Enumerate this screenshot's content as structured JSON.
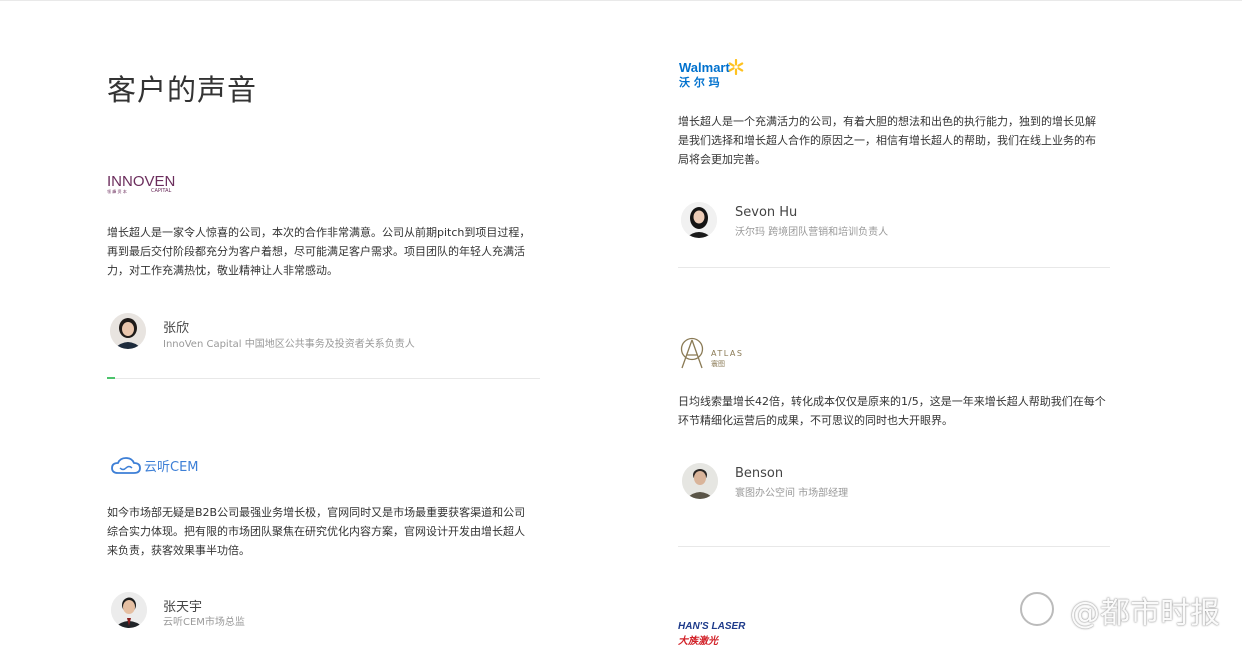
{
  "section_title": "客户的声音",
  "testimonials": [
    {
      "logo": {
        "name": "innoven-capital-logo",
        "main": "INNOVEN",
        "sub_cn": "领 峰 资 本",
        "sub_en": "CAPITAL"
      },
      "quote": "增长超人是一家令人惊喜的公司，本次的合作非常满意。公司从前期pitch到项目过程，再到最后交付阶段都充分为客户着想，尽可能满足客户需求。项目团队的年轻人充满活力，对工作充满热忱，敬业精神让人非常感动。",
      "person": "张欣",
      "role": "InnoVen Capital 中国地区公共事务及投资者关系负责人"
    },
    {
      "logo": {
        "name": "yunting-cem-logo",
        "main": "云听CEM"
      },
      "quote": "如今市场部无疑是B2B公司最强业务增长极，官网同时又是市场最重要获客渠道和公司综合实力体现。把有限的市场团队聚焦在研究优化内容方案，官网设计开发由增长超人来负责，获客效果事半功倍。",
      "person": "张天宇",
      "role": "云听CEM市场总监"
    },
    {
      "logo": {
        "name": "walmart-logo",
        "main": "Walmart",
        "sub_cn": "沃 尔 玛"
      },
      "quote": "增长超人是一个充满活力的公司，有着大胆的想法和出色的执行能力，独到的增长见解是我们选择和增长超人合作的原因之一，相信有增长超人的帮助，我们在线上业务的布局将会更加完善。",
      "person": "Sevon Hu",
      "role": "沃尔玛 跨境团队营销和培训负责人"
    },
    {
      "logo": {
        "name": "atlas-logo",
        "main": "ATLAS",
        "sub_cn": "寰图"
      },
      "quote": "日均线索量增长42倍，转化成本仅仅是原来的1/5，这是一年来增长超人帮助我们在每个环节精细化运营后的成果，不可思议的同时也大开眼界。",
      "person": "Benson",
      "role": "寰图办公空间 市场部经理"
    },
    {
      "logo": {
        "name": "hans-laser-logo",
        "main": "HAN'S LASER",
        "sub_cn": "大族激光"
      }
    }
  ],
  "watermark": "@都市时报",
  "colors": {
    "accent_green": "#4cc36b",
    "walmart_blue": "#0071ce",
    "walmart_yellow": "#ffc220",
    "innoven_purple": "#6b2d5c",
    "hans_red": "#d2232a",
    "hans_blue": "#1d3a8a"
  }
}
